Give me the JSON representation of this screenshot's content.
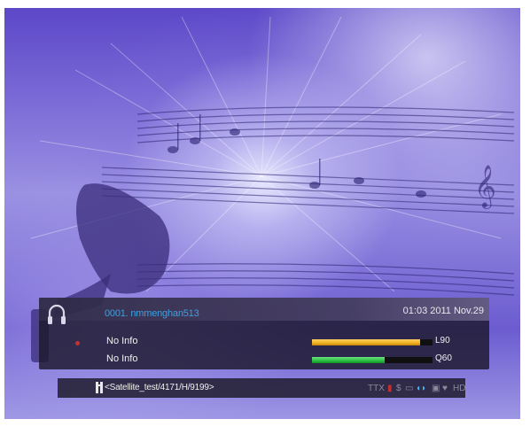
{
  "infobar": {
    "channel": "0001. nmmenghan513",
    "datetime": "01:03 2011 Nov.29",
    "epg_now": "No Info",
    "epg_next": "No Info",
    "signal_level": {
      "label": "L90",
      "value": 0.9,
      "color": "#f0b020"
    },
    "signal_quality": {
      "label": "Q60",
      "value": 0.6,
      "color": "#28c040"
    }
  },
  "bottom": {
    "transponder": "<Satellite_test/4171/H/9199>",
    "status_icons": [
      "ttx-icon",
      "subtitle-icon",
      "scrambled-icon",
      "epg-icon",
      "audio-icon",
      "lock-icon",
      "favorite-icon",
      "hd-icon"
    ],
    "status_glyphs": {
      "ttx": "TTX",
      "scrambled": "$",
      "hd": "HD"
    }
  },
  "colors": {
    "channel_text": "#3ea0e0",
    "panel": "#1c182c",
    "background_purple": "#7a6ad6"
  }
}
